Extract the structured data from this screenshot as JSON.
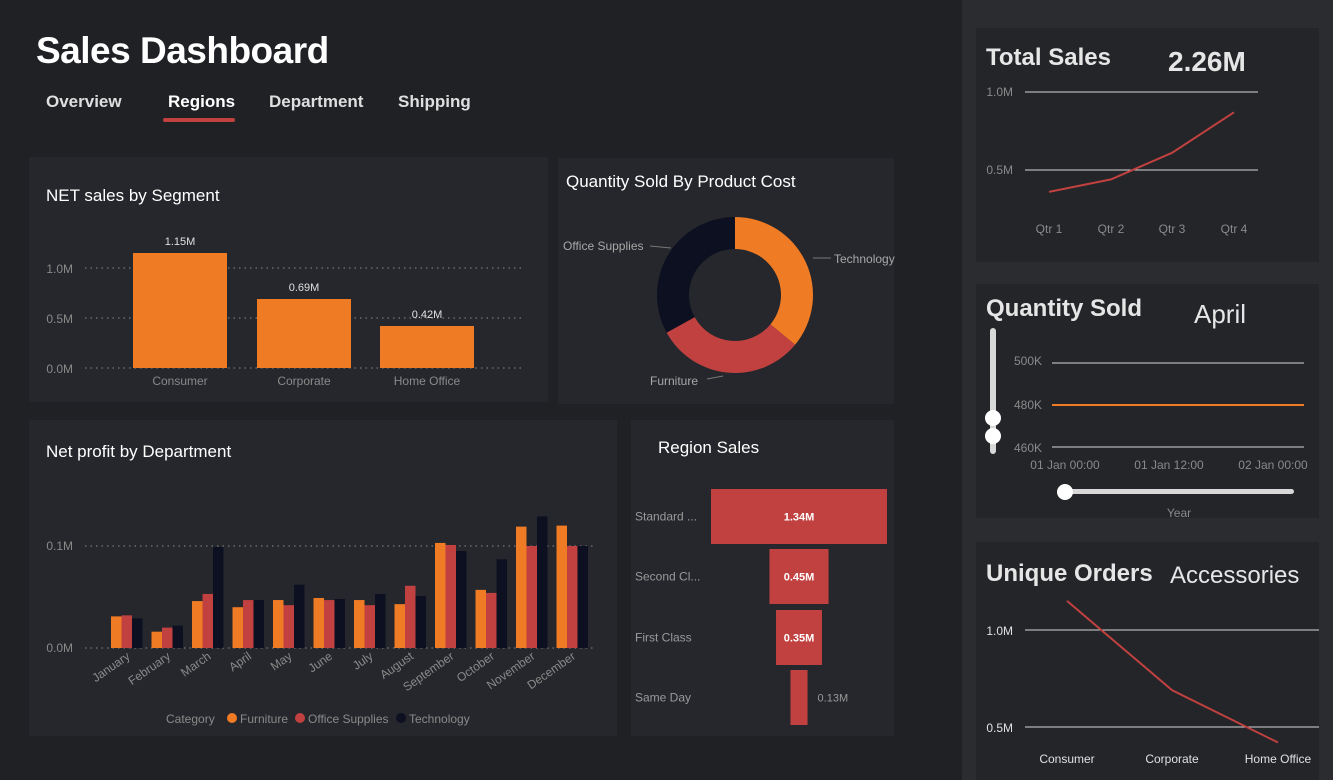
{
  "header": {
    "title": "Sales Dashboard",
    "tabs": [
      {
        "label": "Overview"
      },
      {
        "label": "Regions"
      },
      {
        "label": "Department"
      },
      {
        "label": "Shipping"
      }
    ],
    "active_tab": "Regions"
  },
  "colors": {
    "orange": "#f07b25",
    "red": "#c0413f",
    "navy": "#0c1020",
    "bg": "#1f2125",
    "card": "#25272c"
  },
  "chart_data": [
    {
      "id": "net_sales_by_segment",
      "type": "bar",
      "title": "NET sales by Segment",
      "categories": [
        "Consumer",
        "Corporate",
        "Home Office"
      ],
      "values": [
        1.15,
        0.69,
        0.42
      ],
      "data_labels": [
        "1.15M",
        "0.69M",
        "0.42M"
      ],
      "yticks": [
        "0.0M",
        "0.5M",
        "1.0M"
      ],
      "ylim": [
        0,
        1.15
      ]
    },
    {
      "id": "quantity_by_product_cost",
      "type": "pie",
      "title": "Quantity Sold By Product Cost",
      "labels": [
        "Technology",
        "Furniture",
        "Office Supplies"
      ],
      "values": [
        36,
        31,
        33
      ],
      "colors": [
        "#f07b25",
        "#c0413f",
        "#0c1020"
      ]
    },
    {
      "id": "net_profit_by_department",
      "type": "bar",
      "title": "Net profit by Department",
      "categories": [
        "January",
        "February",
        "March",
        "April",
        "May",
        "June",
        "July",
        "August",
        "September",
        "October",
        "November",
        "December"
      ],
      "series": [
        {
          "name": "Furniture",
          "color": "#f07b25",
          "values": [
            0.031,
            0.016,
            0.046,
            0.04,
            0.047,
            0.049,
            0.047,
            0.043,
            0.103,
            0.057,
            0.119,
            0.12
          ]
        },
        {
          "name": "Office Supplies",
          "color": "#c0413f",
          "values": [
            0.032,
            0.02,
            0.053,
            0.047,
            0.042,
            0.047,
            0.042,
            0.061,
            0.101,
            0.054,
            0.1,
            0.1
          ]
        },
        {
          "name": "Technology",
          "color": "#0c1020",
          "values": [
            0.029,
            0.022,
            0.099,
            0.047,
            0.062,
            0.048,
            0.053,
            0.051,
            0.095,
            0.087,
            0.129,
            0.1
          ]
        }
      ],
      "yticks": [
        "0.0M",
        "0.1M"
      ],
      "ylim": [
        0,
        0.1
      ],
      "legend_label": "Category"
    },
    {
      "id": "region_sales",
      "type": "bar",
      "title": "Region Sales",
      "categories": [
        "Standard ...",
        "Second Cl...",
        "First Class",
        "Same Day"
      ],
      "values": [
        1.34,
        0.45,
        0.35,
        0.13
      ],
      "data_labels": [
        "1.34M",
        "0.45M",
        "0.35M",
        "0.13M"
      ]
    },
    {
      "id": "total_sales",
      "type": "line",
      "title": "Total Sales",
      "kpi": "2.26M",
      "x": [
        "Qtr 1",
        "Qtr 2",
        "Qtr 3",
        "Qtr 4"
      ],
      "values": [
        0.36,
        0.44,
        0.61,
        0.87
      ],
      "yticks": [
        "0.5M",
        "1.0M"
      ],
      "ylim": [
        0.5,
        1.0
      ]
    },
    {
      "id": "quantity_sold",
      "type": "line",
      "title": "Quantity Sold",
      "kpi": "April",
      "x": [
        "01 Jan 00:00",
        "01 Jan 12:00",
        "02 Jan 00:00"
      ],
      "values": [
        480000,
        480000,
        480000
      ],
      "yticks": [
        "460K",
        "480K",
        "500K"
      ],
      "ylim": [
        460000,
        500000
      ],
      "xlabel": "Year"
    },
    {
      "id": "unique_orders",
      "type": "line",
      "title": "Unique Orders",
      "kpi": "Accessories",
      "x": [
        "Consumer",
        "Corporate",
        "Home Office"
      ],
      "values": [
        1.15,
        0.69,
        0.42
      ],
      "yticks": [
        "0.5M",
        "1.0M"
      ],
      "ylim": [
        0.5,
        1.0
      ]
    }
  ]
}
